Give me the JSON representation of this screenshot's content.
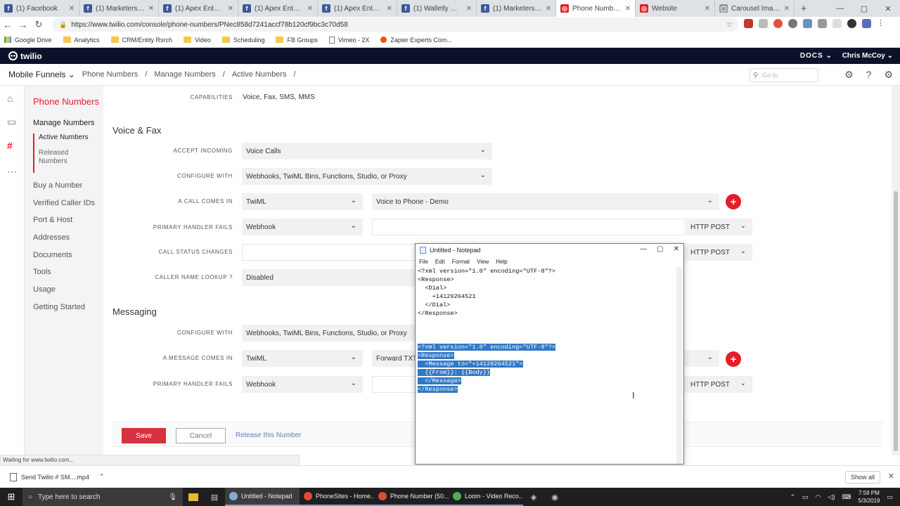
{
  "browser": {
    "tabs": [
      {
        "title": "(1) Facebook",
        "color": "#3b5998",
        "glyph": "f"
      },
      {
        "title": "(1) Marketers Mind",
        "color": "#3b5998",
        "glyph": "f"
      },
      {
        "title": "(1) Apex Entourage",
        "color": "#3b5998",
        "glyph": "f"
      },
      {
        "title": "(1) Apex Entourage",
        "color": "#3b5998",
        "glyph": "f"
      },
      {
        "title": "(1) Apex Entourage",
        "color": "#3b5998",
        "glyph": "f"
      },
      {
        "title": "(1) Walletly Comm",
        "color": "#3b5998",
        "glyph": "f"
      },
      {
        "title": "(1) Marketers Mind",
        "color": "#3b5998",
        "glyph": "f"
      },
      {
        "title": "Phone Number (50",
        "color": "#e31e26",
        "glyph": "◎"
      },
      {
        "title": "Website",
        "color": "#e31e26",
        "glyph": "◎"
      },
      {
        "title": "Carousel Image De",
        "color": "#999999",
        "glyph": "▢"
      }
    ],
    "url": "https://www.twilio.com/console/phone-numbers/PNec858d7241accf78b120cf9bc3c70d58",
    "bookmarks": [
      {
        "label": "Google Drive",
        "type": "drive"
      },
      {
        "label": "Analytics",
        "type": "folder"
      },
      {
        "label": "CRM/Entity Rsrch",
        "type": "folder"
      },
      {
        "label": "Video",
        "type": "folder"
      },
      {
        "label": "Scheduling",
        "type": "folder"
      },
      {
        "label": "FB Groups",
        "type": "folder"
      },
      {
        "label": "Vimeo - 2X",
        "type": "page"
      },
      {
        "label": "Zapier Experts Com...",
        "type": "zapier"
      }
    ]
  },
  "twilio": {
    "logo": "twilio",
    "docs": "DOCS",
    "user": "Chris McCoy",
    "project": "Mobile Funnels",
    "breadcrumb": [
      "Phone Numbers",
      "Manage Numbers",
      "Active Numbers"
    ],
    "search_placeholder": "Go to"
  },
  "leftnav": {
    "title": "Phone Numbers",
    "manage": "Manage Numbers",
    "active": "Active Numbers",
    "released": "Released Numbers",
    "items": [
      "Buy a Number",
      "Verified Caller IDs",
      "Port & Host",
      "Addresses",
      "Documents",
      "Tools",
      "Usage",
      "Getting Started"
    ]
  },
  "form": {
    "capabilities_label": "CAPABILITIES",
    "capabilities_value": "Voice, Fax, SMS, MMS",
    "voice_section": "Voice & Fax",
    "accept_incoming_label": "ACCEPT INCOMING",
    "accept_incoming_value": "Voice Calls",
    "configure_with_label": "CONFIGURE WITH",
    "configure_with_value": "Webhooks, TwiML Bins, Functions, Studio, or Proxy",
    "call_comes_in_label": "A CALL COMES IN",
    "call_comes_in_type": "TwiML",
    "call_comes_in_value": "Voice to Phone - Demo",
    "primary_fails_label": "PRIMARY HANDLER FAILS",
    "primary_fails_type": "Webhook",
    "http_post": "HTTP POST",
    "call_status_label": "CALL STATUS CHANGES",
    "caller_lookup_label": "CALLER NAME LOOKUP",
    "caller_lookup_value": "Disabled",
    "messaging_section": "Messaging",
    "msg_configure_label": "CONFIGURE WITH",
    "msg_configure_value": "Webhooks, TwiML Bins, Functions, Studio, or Proxy",
    "msg_comes_in_label": "A MESSAGE COMES IN",
    "msg_comes_in_type": "TwiML",
    "msg_comes_in_value": "Forward TXT",
    "msg_fails_label": "PRIMARY HANDLER FAILS",
    "msg_fails_type": "Webhook",
    "save": "Save",
    "cancel": "Cancel",
    "release": "Release this Number"
  },
  "notepad": {
    "title": "Untitled - Notepad",
    "menu": [
      "File",
      "Edit",
      "Format",
      "View",
      "Help"
    ],
    "lines": [
      {
        "text": "<?xml version=\"1.0\" encoding=\"UTF-8\"?>",
        "hl": false
      },
      {
        "text": "<Response>",
        "hl": false
      },
      {
        "text": "  <Dial>",
        "hl": false
      },
      {
        "text": "    +14129264521",
        "hl": false
      },
      {
        "text": "  </Dial>",
        "hl": false
      },
      {
        "text": "</Response>",
        "hl": false
      },
      {
        "text": "",
        "hl": false
      },
      {
        "text": "",
        "hl": false
      },
      {
        "text": "",
        "hl": false
      },
      {
        "text": "<?xml version=\"1.0\" encoding=\"UTF-8\"?>",
        "hl": true
      },
      {
        "text": "<Response>",
        "hl": true
      },
      {
        "text": "  <Message to=\"+14129264521\">",
        "hl": true
      },
      {
        "text": "  {{From}}: {{Body}}",
        "hl": true
      },
      {
        "text": "  </Message>",
        "hl": true
      },
      {
        "text": "</Response>",
        "hl": true
      }
    ]
  },
  "status": {
    "loading": "Waiting for www.twilio.com...",
    "download_name": "Send Twilio # SM....mp4",
    "show_all": "Show all"
  },
  "taskbar": {
    "search_placeholder": "Type here to search",
    "apps": [
      {
        "label": "Untitled - Notepad",
        "active": true,
        "color": "#8aa9d6"
      },
      {
        "label": "PhoneSites - Home...",
        "active": false,
        "color": "#dd4b39"
      },
      {
        "label": "Phone Number (50...",
        "active": false,
        "color": "#dd4b39"
      },
      {
        "label": "Loom - Video Reco...",
        "active": false,
        "color": "#4caf50"
      }
    ],
    "time": "7:59 PM",
    "date": "5/3/2019"
  }
}
